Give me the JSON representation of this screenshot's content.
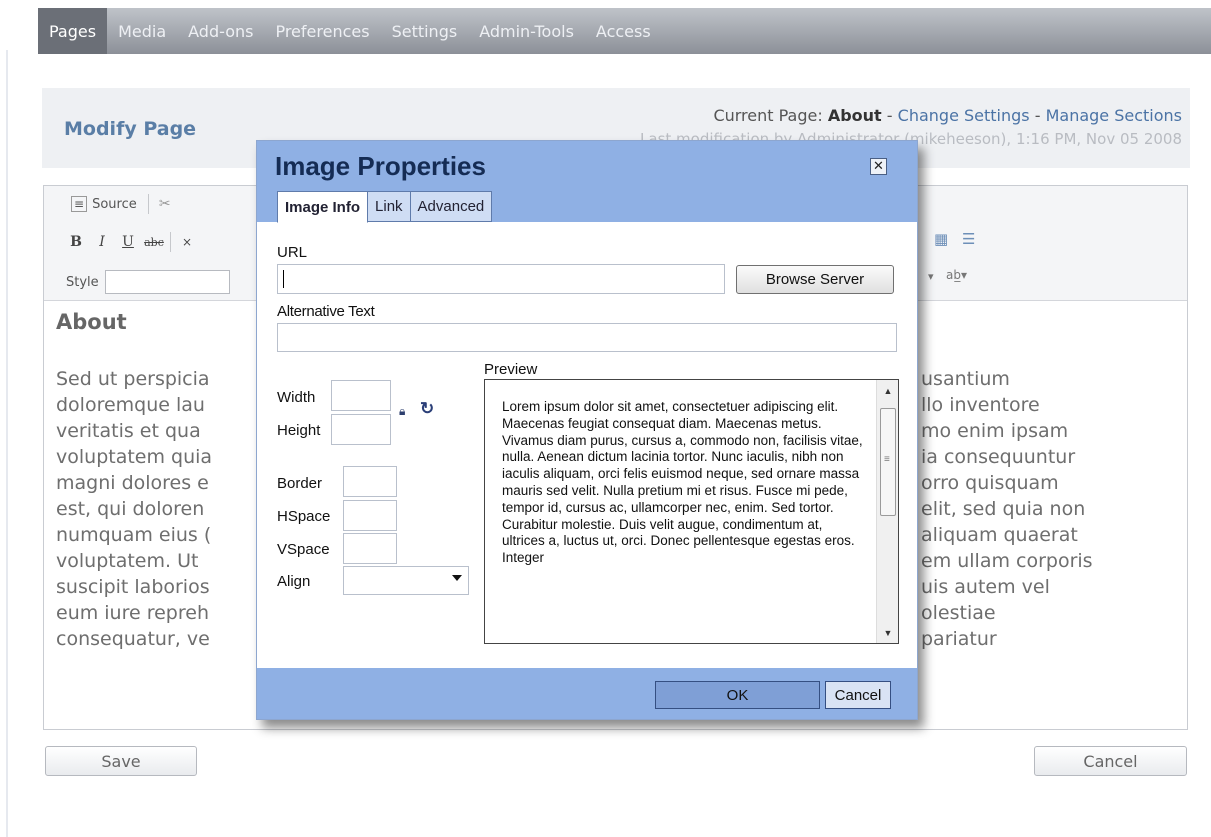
{
  "nav": {
    "items": [
      {
        "label": "Pages",
        "active": true
      },
      {
        "label": "Media",
        "active": false
      },
      {
        "label": "Add-ons",
        "active": false
      },
      {
        "label": "Preferences",
        "active": false
      },
      {
        "label": "Settings",
        "active": false
      },
      {
        "label": "Admin-Tools",
        "active": false
      },
      {
        "label": "Access",
        "active": false
      }
    ]
  },
  "header": {
    "title": "Modify Page",
    "current_prefix": "Current Page: ",
    "current_page": "About",
    "sep1": " - ",
    "change_settings": "Change Settings",
    "sep2": " - ",
    "manage_sections": "Manage Sections",
    "last_modified": "Last modification by Administrator (mikeheeson), 1:16 PM, Nov 05 2008"
  },
  "toolbar": {
    "source_label": "Source",
    "bold": "B",
    "italic": "I",
    "underline": "U",
    "strike": "abc",
    "style_label": "Style"
  },
  "editor": {
    "heading": "About",
    "lines_left": [
      "Sed ut perspicia",
      "doloremque lau",
      "veritatis et qua",
      "voluptatem quia",
      "magni dolores e",
      "est, qui doloren",
      "numquam eius (",
      "voluptatem. Ut",
      "suscipit laborios",
      "eum iure repreh",
      "consequatur, ve"
    ],
    "lines_right": [
      "usantium",
      "llo inventore",
      "mo enim ipsam",
      "ia consequuntur",
      "orro quisquam",
      "elit, sed quia non",
      "aliquam quaerat",
      "em ullam corporis",
      "uis autem vel",
      "olestiae",
      "pariatur"
    ]
  },
  "buttons": {
    "save": "Save",
    "cancel": "Cancel"
  },
  "dialog": {
    "title": "Image Properties",
    "close": "✕",
    "tabs": [
      {
        "label": "Image Info",
        "active": true
      },
      {
        "label": "Link",
        "active": false
      },
      {
        "label": "Advanced",
        "active": false
      }
    ],
    "url_label": "URL",
    "url_value": "",
    "browse_label": "Browse Server",
    "alt_label": "Alternative Text",
    "alt_value": "",
    "width_label": "Width",
    "height_label": "Height",
    "border_label": "Border",
    "hspace_label": "HSpace",
    "vspace_label": "VSpace",
    "align_label": "Align",
    "align_value": "",
    "preview_label": "Preview",
    "preview_text": "Lorem ipsum dolor sit amet, consectetuer adipiscing elit. Maecenas feugiat consequat diam. Maecenas metus. Vivamus diam purus, cursus a, commodo non, facilisis vitae, nulla. Aenean dictum lacinia tortor. Nunc iaculis, nibh non iaculis aliquam, orci felis euismod neque, sed ornare massa mauris sed velit. Nulla pretium mi et risus. Fusce mi pede, tempor id, cursus ac, ullamcorper nec, enim. Sed tortor. Curabitur molestie. Duis velit augue, condimentum at, ultrices a, luctus ut, orci. Donec pellentesque egestas eros. Integer",
    "ok_label": "OK",
    "cancel_label": "Cancel"
  }
}
